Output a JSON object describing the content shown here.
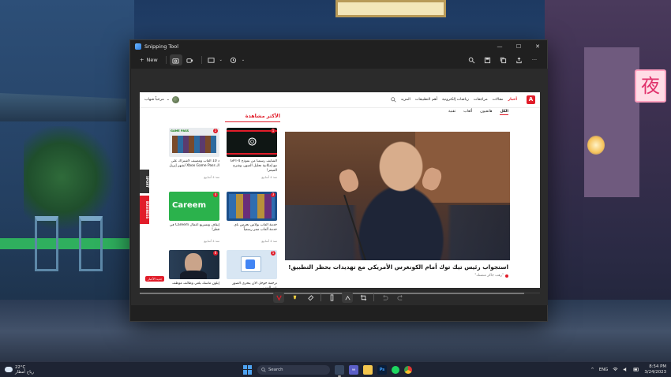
{
  "window": {
    "title": "Snipping Tool",
    "new_label": "New",
    "controls": [
      "—",
      "☐",
      "✕"
    ]
  },
  "site": {
    "profile_name": "مرحباً شهاب",
    "nav": [
      "المزيد",
      "أهم التطبيقات",
      "رياضات إلكترونية",
      "مراجعات",
      "مقالات",
      "أخبار"
    ],
    "nav_active": "أخبار",
    "logo": "A",
    "subnav": [
      "تقنية",
      "ألعاب",
      "هاتفيون",
      "الكل"
    ],
    "subnav_active": "الكل",
    "trending_title": "الأكثر مشاهدة",
    "side_tabs": [
      "SPORT",
      "BUSINESS"
    ],
    "badge": "جديد الأخبار",
    "hero": {
      "title": "استجواب رئيس تيك توك أمام الكونغرس الأمريكي مع تهديدات بحظر التطبيق!",
      "meta": "\"رهب جاكر منصتك\""
    },
    "cards": [
      {
        "num": "1",
        "title": "الشايف رسمياً من نموذج GPT-4 مع إمكانية تحليل الصور، وشرح الميمز!",
        "time": "منذ 4 أسابيع"
      },
      {
        "num": "2",
        "title": "د 10 ألعاب ومضيف لاشتراك على الـ Xbox Game Pass لشهر إبريل",
        "time": "منذ 4 أسابيع"
      },
      {
        "num": "3",
        "title": "خدمة العاب بولاس تحرس بأي خدمة ألعاب ممر رسمياً",
        "time": "منذ 4 أسابيع"
      },
      {
        "num": "4",
        "title": "إيقاف وتسريع أعمال Careem في قطر!",
        "time": "منذ 4 أسابيع"
      },
      {
        "num": "5",
        "title": "ترجمة جوجل الآن يتحرى الصور عبر الويب",
        "time": ""
      },
      {
        "num": "6",
        "title": "إيلون ماسك يلغي وظائف موظف",
        "time": ""
      }
    ],
    "card_labels": [
      "GAME PASS",
      "Careem"
    ]
  },
  "taskbar": {
    "temp": "22°C",
    "weather_text": "رياح أمطار",
    "search_placeholder": "Search",
    "lang": "ENG",
    "time": "8:54 PM",
    "date": "3/24/2023",
    "teams_badge": "99"
  },
  "wallpaper": {
    "sign_glyph": "夜"
  },
  "colors": {
    "accent": "#e11d2a",
    "window_bg": "#202020",
    "taskbar": "#1e2433"
  }
}
